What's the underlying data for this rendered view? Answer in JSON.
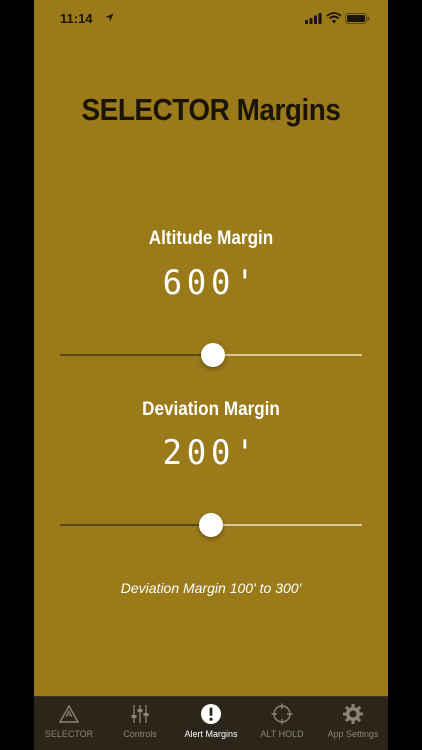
{
  "status_bar": {
    "time": "11:14"
  },
  "page": {
    "title": "SELECTOR Margins"
  },
  "altitude": {
    "label": "Altitude Margin",
    "value": "600'",
    "slider_fraction": 0.506
  },
  "deviation": {
    "label": "Deviation Margin",
    "value": "200'",
    "slider_fraction": 0.5
  },
  "note": "Deviation Margin 100' to 300'",
  "tabs": [
    {
      "label": "SELECTOR",
      "icon": "warning-triangle-icon",
      "active": false
    },
    {
      "label": "Controls",
      "icon": "sliders-icon",
      "active": false
    },
    {
      "label": "Alert Margins",
      "icon": "exclamation-circle-icon",
      "active": true
    },
    {
      "label": "ALT HOLD",
      "icon": "crosshair-icon",
      "active": false
    },
    {
      "label": "App Settings",
      "icon": "gear-icon",
      "active": false
    }
  ],
  "colors": {
    "background": "#9a7a19",
    "tabbar": "#2b2619",
    "title_text": "#1a1508",
    "active_tab": "#ffffff",
    "inactive_tab": "#8a8474"
  }
}
